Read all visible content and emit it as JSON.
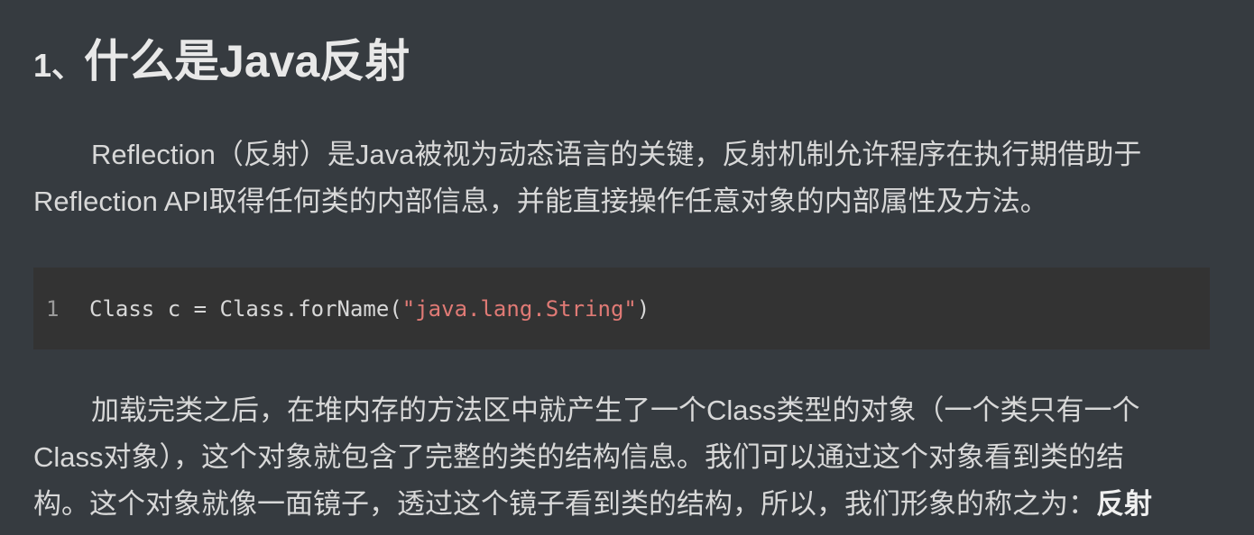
{
  "article": {
    "heading": {
      "number": "1、",
      "text": "什么是Java反射"
    },
    "paragraph1": {
      "line1": "Reflection（反射）是Java被视为动态语言的关键，反射机制允许程序在执行期借助于",
      "line2": "Reflection API取得任何类的内部信息，并能直接操作任意对象的内部属性及方法。"
    },
    "code": {
      "line_number": "1",
      "before_string": "Class c = Class.forName(",
      "string": "\"java.lang.String\"",
      "after_string": ")"
    },
    "paragraph2": {
      "line1": "加载完类之后，在堆内存的方法区中就产生了一个Class类型的对象（一个类只有一个",
      "line2": "Class对象），这个对象就包含了完整的类的结构信息。我们可以通过这个对象看到类的结",
      "line3_before_bold": "构。这个对象就像一面镜子，透过这个镜子看到类的结构，所以，我们形象的称之为：",
      "line3_bold": "反射"
    }
  }
}
